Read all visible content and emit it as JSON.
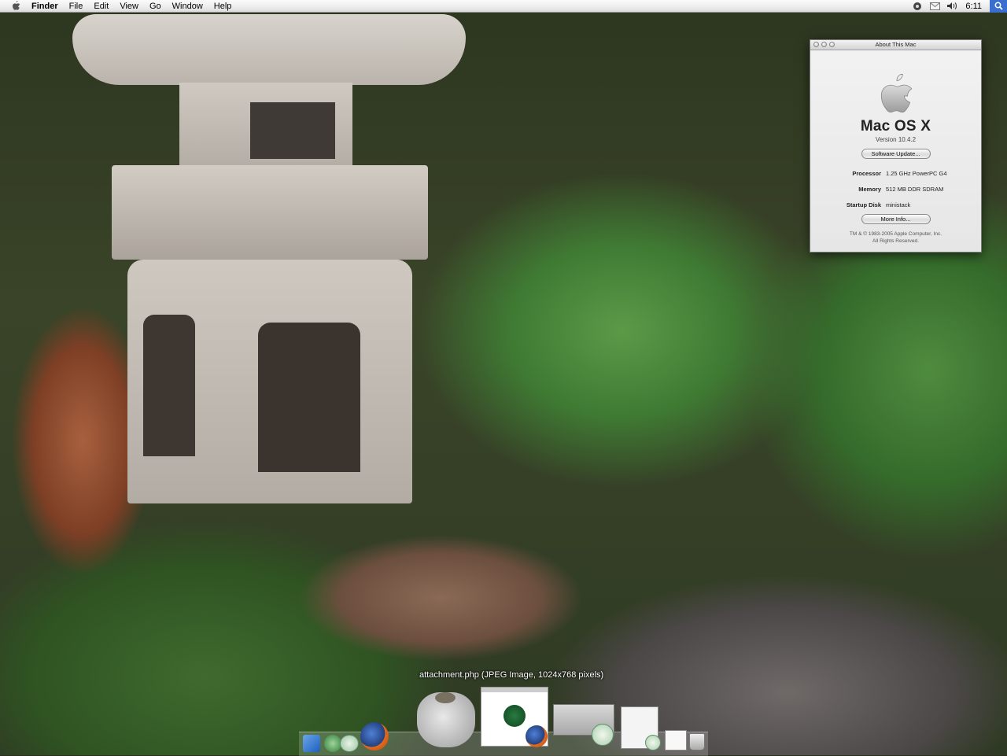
{
  "menubar": {
    "app_name": "Finder",
    "items": [
      "File",
      "Edit",
      "View",
      "Go",
      "Window",
      "Help"
    ],
    "clock": "6:11"
  },
  "about_window": {
    "title": "About This Mac",
    "product": "Mac OS X",
    "version": "Version 10.4.2",
    "software_update_label": "Software Update...",
    "specs": [
      {
        "key": "Processor",
        "value": "1.25 GHz PowerPC G4"
      },
      {
        "key": "Memory",
        "value": "512 MB DDR SDRAM"
      },
      {
        "key": "Startup Disk",
        "value": "ministack"
      }
    ],
    "more_info_label": "More Info...",
    "copyright_line1": "TM & © 1983-2005 Apple Computer, Inc.",
    "copyright_line2": "All Rights Reserved."
  },
  "dock": {
    "hover_label": "attachment.php (JPEG Image, 1024x768 pixels)"
  }
}
